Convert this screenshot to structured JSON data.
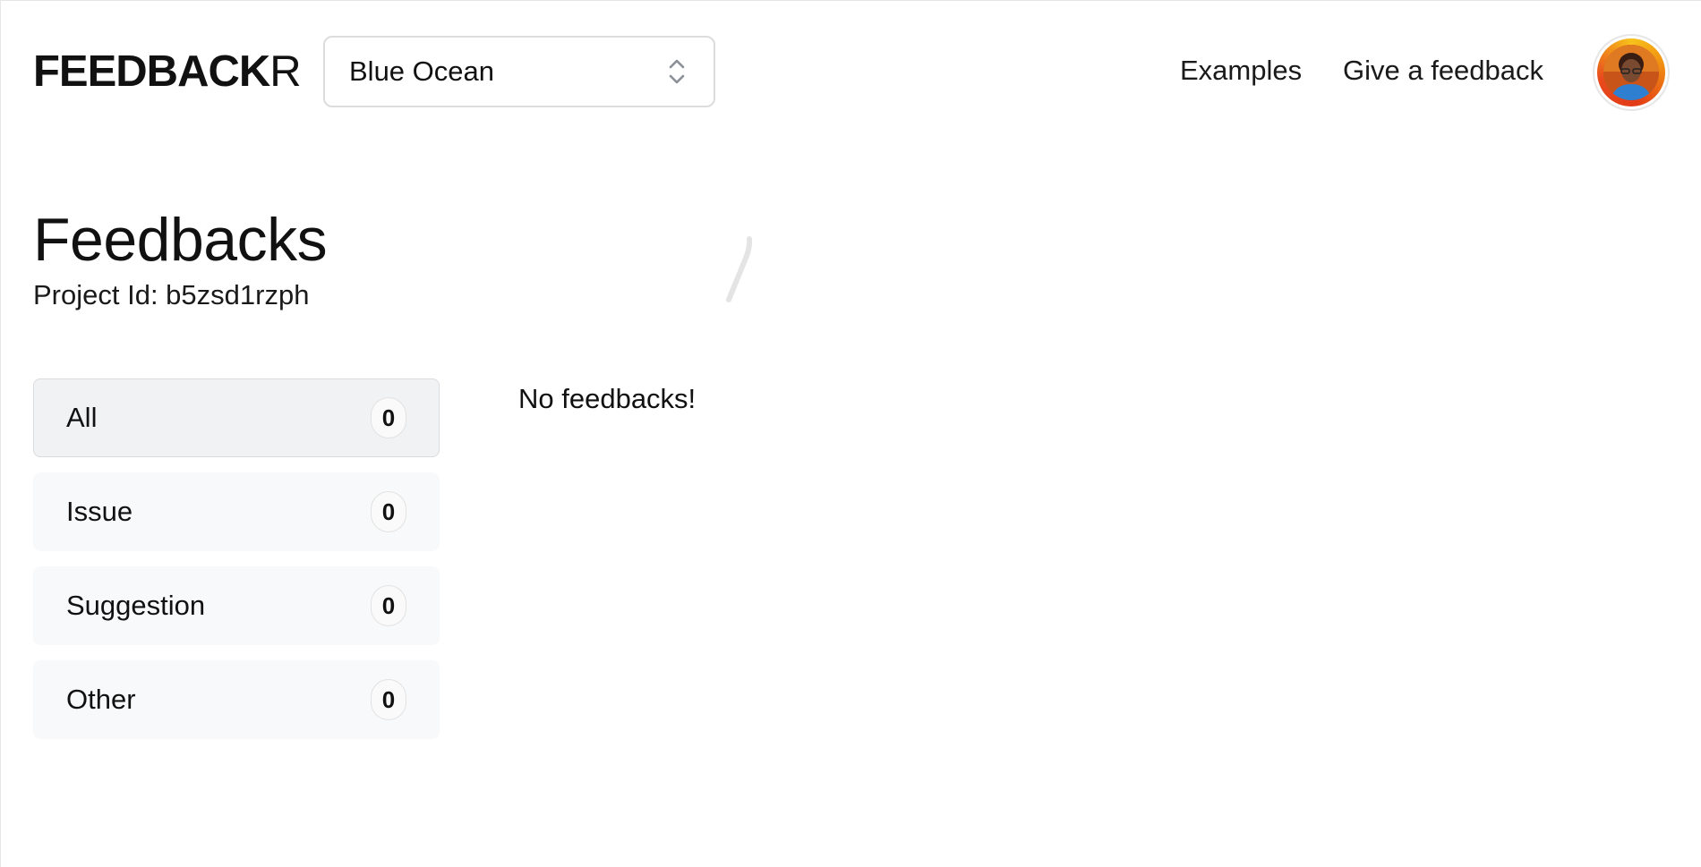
{
  "header": {
    "logo_bold": "FEEDBACK",
    "logo_light": "R",
    "project_select": {
      "value": "Blue Ocean",
      "icon": "chevron-up-down-icon"
    },
    "nav": {
      "examples": "Examples",
      "give_feedback": "Give a feedback"
    },
    "avatar_icon": "user-avatar"
  },
  "main": {
    "title": "Feedbacks",
    "project_id": "Project Id: b5zsd1rzph",
    "empty_message": "No feedbacks!"
  },
  "categories": [
    {
      "label": "All",
      "count": "0"
    },
    {
      "label": "Issue",
      "count": "0"
    },
    {
      "label": "Suggestion",
      "count": "0"
    },
    {
      "label": "Other",
      "count": "0"
    }
  ],
  "colors": {
    "active_item_bg": "#f1f2f4",
    "item_bg": "#f8f9fa",
    "border": "#dcdcdc",
    "text": "#111111"
  }
}
